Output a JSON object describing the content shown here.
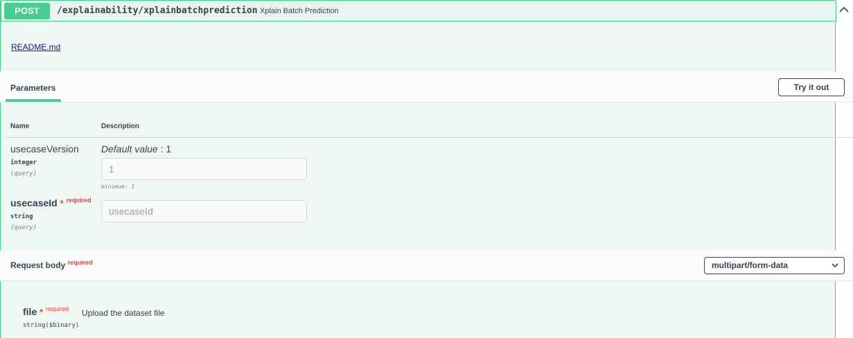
{
  "operation": {
    "method": "POST",
    "path": "/explainability/xplainbatchprediction",
    "summary": "Xplain Batch Prediction",
    "collapse_icon": "chevron-up-icon"
  },
  "description": {
    "readme_link": "README.md"
  },
  "parameters_section": {
    "tab_label": "Parameters",
    "try_button": "Try it out",
    "column_name": "Name",
    "column_description": "Description",
    "params": [
      {
        "name": "usecaseVersion",
        "type": "integer",
        "in": "(query)",
        "default_label": "Default value",
        "default_sep": " : 1",
        "value": "1",
        "minimum": "minimum: 1"
      },
      {
        "name": "usecaseId",
        "star": "*",
        "required": "required",
        "type": "string",
        "in": "(query)",
        "placeholder": "usecaseId"
      }
    ]
  },
  "request_body": {
    "label": "Request body",
    "required": "required",
    "content_type": "multipart/form-data",
    "fields": [
      {
        "name": "file",
        "star": "*",
        "required": "required",
        "description": "Upload the dataset file",
        "type": "string($binary)"
      }
    ]
  },
  "colors": {
    "post_green": "#49cc90",
    "background": "#eef9f3",
    "required_red": "#ff3b3b"
  }
}
